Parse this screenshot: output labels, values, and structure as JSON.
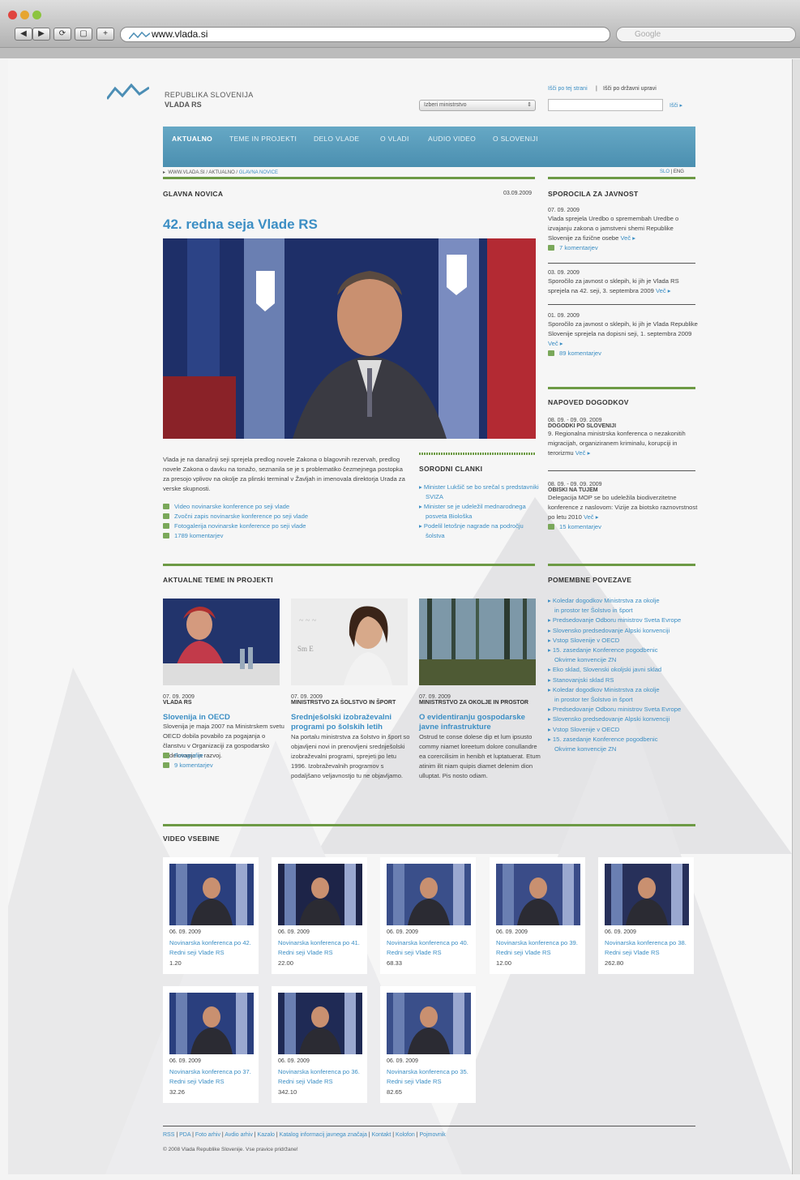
{
  "browser": {
    "url": "www.vlada.si",
    "search_placeholder": "Google",
    "nav_buttons": [
      "◀",
      "▶",
      "⟳",
      "▢",
      "+"
    ]
  },
  "header": {
    "republic": "REPUBLIKA SLOVENIJA",
    "gov": "VLADA RS",
    "search_this": "Išči po tej strani",
    "search_sep": "|",
    "search_all": "Išči po državni upravi",
    "ministry_select": "Izberi ministrstvo",
    "search_button": "Išči"
  },
  "nav": [
    "AKTUALNO",
    "TEME IN PROJEKTI",
    "DELO VLADE",
    "O VLADI",
    "AUDIO VIDEO",
    "O SLOVENIJI"
  ],
  "breadcrumb": {
    "home": "WWW.VLADA.SI",
    "sep": "/",
    "section": "AKTUALNO",
    "current": "GLAVNA NOVICE",
    "lang_slo": "SLO",
    "lang_sep": "|",
    "lang_eng": "ENG"
  },
  "main_news": {
    "label": "GLAVNA NOVICA",
    "date": "03.09.2009",
    "title": "42. redna seja Vlade RS",
    "text": "Vlada je na današnji seji sprejela predlog novele Zakona o blagovnih rezervah, predlog novele Zakona o davku na tonažo, seznanila se je s problematiko čezmejnega postopka za presojo vplivov na okolje za plinski terminal v Žavljah in imenovala direktorja Urada za verske skupnosti.",
    "links": [
      "Video novinarske konference po seji vlade",
      "Zvočni zapis novinarske konference po seji vlade",
      "Fotogalerija novinarske konference po seji vlade",
      "1789 komentarjev"
    ]
  },
  "related": {
    "title": "SORODNI CLANKI",
    "items": [
      "Minister Lukšič se bo srečal s predstavniki SVIZA",
      "Minister se je udeležil mednarodnega posveta Biološka",
      "Podelil letošnje nagrade na področju šolstva"
    ]
  },
  "press": {
    "title": "SPOROCILA ZA JAVNOST",
    "items": [
      {
        "date": "07. 09. 2009",
        "text": "Vlada sprejela Uredbo o spremembah Uredbe o izvajanju zakona o jamstveni shemi Republike Slovenije za fizične osebe",
        "more": "Več",
        "comments": "7 komentarjev"
      },
      {
        "date": "03. 09. 2009",
        "text": "Sporočilo za javnost o sklepih, ki jih je Vlada RS sprejela na 42. seji, 3. septembra 2009",
        "more": "Več",
        "comments": ""
      },
      {
        "date": "01. 09. 2009",
        "text": "Sporočilo za javnost o sklepih, ki jih je Vlada Republike Slovenije sprejela na dopisni seji, 1. septembra 2009",
        "more": "Več",
        "comments": "89 komentarjev"
      }
    ]
  },
  "events": {
    "title": "NAPOVED DOGODKOV",
    "items": [
      {
        "date": "08. 09. - 09. 09. 2009",
        "org": "DOGODKI PO SLOVENIJI",
        "text": "9. Regionalna ministrska konferenca o nezakonitih migracijah, organiziranem kriminalu, korupciji in terorizmu",
        "more": "Več",
        "comments": ""
      },
      {
        "date": "08. 09. - 09. 09. 2009",
        "org": "OBISKI NA TUJEM",
        "text": "Delegacija MOP se bo udeležila biodiverzitetne konference z naslovom: Vizije za biotsko raznovrstnost po letu 2010",
        "more": "Več",
        "comments": "15 komentarjev"
      }
    ]
  },
  "topics": {
    "title": "AKTUALNE TEME IN PROJEKTI",
    "items": [
      {
        "date": "07. 09. 2009",
        "org": "VLADA RS",
        "title": "Slovenija in OECD",
        "text": "Slovenija je maja 2007 na Ministrskem svetu OECD dobila povabilo za pogajanja o članstvu v Organizaciji za gospodarsko sodelovanje in razvoj.",
        "extra": "Fotografije",
        "comments": "9 komentarjev"
      },
      {
        "date": "07. 09. 2009",
        "org": "MINISTRSTVO ZA ŠOLSTVO IN ŠPORT",
        "title": "Srednješolski izobraževalni programi po šolskih letih",
        "text": "Na portalu ministrstva za šolstvo in šport so objavljeni novi in prenovljeni srednješolski izobraževalni programi, sprejeti po letu 1996. Izobraževalnih programov s podaljšano veljavnostjo tu ne objavljamo.",
        "extra": "",
        "comments": ""
      },
      {
        "date": "07. 09. 2009",
        "org": "MINISTRSTVO ZA OKOLJE IN PROSTOR",
        "title": "O evidentiranju gospodarske javne infrastrukture",
        "text": "Ostrud te conse dolese dip et lum ipsusto commy niamet loreetum dolore conullandre ea corercilisim in henibh et luptatuerat. Etum atinim ilit niam quipis diamet delenim dion ulluptat. Pis nosto odiam.",
        "extra": "",
        "comments": ""
      }
    ]
  },
  "links": {
    "title": "POMEMBNE POVEZAVE",
    "items": [
      "Koledar dogodkov Ministrstva za okolje|in prostor ter Šolstvo in šport",
      "Predsedovanje Odboru ministrov Sveta Evrope",
      "Slovensko predsedovanje Alpski konvenciji",
      "Vstop Slovenije v OECD",
      "15. zasedanje Konference pogodbenic|Okvirne konvencije ZN",
      "Eko sklad, Slovenski okoljski javni sklad",
      "Stanovanjski sklad RS",
      "Koledar dogodkov Ministrstva za okolje|in prostor ter Šolstvo in šport",
      "Predsedovanje Odboru ministrov Sveta Evrope",
      "Slovensko predsedovanje Alpski konvenciji",
      "Vstop Slovenije v OECD",
      "15. zasedanje Konference pogodbenic|Okvirne konvencije ZN"
    ]
  },
  "video": {
    "title": "VIDEO VSEBINE",
    "items": [
      {
        "date": "06. 09. 2009",
        "title": "Novinarska konferenca po 42. Redni seji Vlade RS",
        "len": "1.20"
      },
      {
        "date": "06. 09. 2009",
        "title": "Novinarska konferenca po 41. Redni seji Vlade RS",
        "len": "22.00"
      },
      {
        "date": "06. 09. 2009",
        "title": "Novinarska konferenca po 40. Redni seji Vlade RS",
        "len": "68.33"
      },
      {
        "date": "06. 09. 2009",
        "title": "Novinarska konferenca po 39. Redni seji Vlade RS",
        "len": "12.00"
      },
      {
        "date": "06. 09. 2009",
        "title": "Novinarska konferenca po 38. Redni seji Vlade RS",
        "len": "262.80"
      },
      {
        "date": "06. 09. 2009",
        "title": "Novinarska konferenca po 37. Redni seji Vlade RS",
        "len": "32.26"
      },
      {
        "date": "06. 09. 2009",
        "title": "Novinarska konferenca po 36. Redni seji Vlade RS",
        "len": "342.10"
      },
      {
        "date": "06. 09. 2009",
        "title": "Novinarska konferenca po 35. Redni seji Vlade RS",
        "len": "82.65"
      }
    ]
  },
  "footer": {
    "links": [
      "RSS",
      "PDA",
      "Foto arhiv",
      "Avdio arhiv",
      "Kazalo",
      "Katalog informacij javnega značaja",
      "Kontakt",
      "Kolofon",
      "Pojmovnik"
    ],
    "copyright": "© 2008 Vlada Republike Slovenije. Vse pravice pridržane!"
  }
}
